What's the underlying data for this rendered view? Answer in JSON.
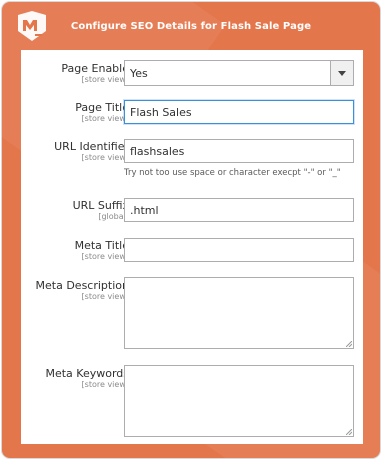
{
  "header": {
    "logo_text": "ME",
    "title": "Configure SEO Details for Flash Sale Page"
  },
  "form": {
    "page_enable": {
      "label": "Page Enable",
      "scope": "[store view]",
      "value": "Yes"
    },
    "page_title": {
      "label": "Page Title",
      "scope": "[store view]",
      "value": "Flash Sales"
    },
    "url_identifier": {
      "label": "URL Identifier",
      "scope": "[store view]",
      "value": "flashsales",
      "note": "Try not too use space or character execpt \"-\" or \"_\""
    },
    "url_suffix": {
      "label": "URL Suffix",
      "scope": "[global]",
      "value": ".html"
    },
    "meta_title": {
      "label": "Meta Title",
      "scope": "[store view]",
      "value": ""
    },
    "meta_description": {
      "label": "Meta Description",
      "scope": "[store view]",
      "value": ""
    },
    "meta_keywords": {
      "label": "Meta Keywords",
      "scope": "[store view]",
      "value": ""
    }
  },
  "colors": {
    "brand": "#e4764c",
    "focus_border": "#3e8ede",
    "field_border": "#adadad"
  }
}
